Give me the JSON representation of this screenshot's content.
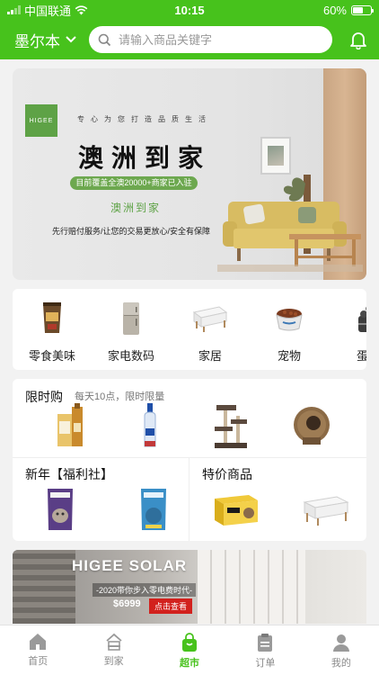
{
  "status_bar": {
    "carrier": "中国联通",
    "time": "10:15",
    "battery": "60%",
    "battery_level": 0.6
  },
  "header": {
    "city": "墨尔本",
    "search_placeholder": "请输入商品关键字"
  },
  "banner": {
    "logo_text": "HIGEE",
    "slogan": "专心为您打造品质生活",
    "title": "澳洲到家",
    "pill": "目前覆盖全澳20000+商家已入驻",
    "subtitle": "澳洲到家",
    "note": "先行赔付服务/让您的交易更放心/安全有保障"
  },
  "categories": [
    {
      "label": "零食美味",
      "icon": "snack-icon"
    },
    {
      "label": "家电数码",
      "icon": "fridge-icon"
    },
    {
      "label": "家居",
      "icon": "furniture-icon"
    },
    {
      "label": "宠物",
      "icon": "pet-bowl-icon"
    },
    {
      "label": "蛋糕",
      "icon": "cake-icon"
    }
  ],
  "flash_sale": {
    "title": "限时购",
    "subtitle": "每天10点，限时限量"
  },
  "new_year": {
    "title": "新年【福利社】"
  },
  "special": {
    "title": "特价商品"
  },
  "solar_banner": {
    "title": "HIGEE SOLAR",
    "tagline": "-2020带你步入零电费时代-",
    "price": "$6999",
    "cta": "点击查看"
  },
  "tabs": [
    {
      "label": "首页",
      "icon": "home-icon"
    },
    {
      "label": "到家",
      "icon": "house-icon"
    },
    {
      "label": "超市",
      "icon": "shopping-bag-icon",
      "active": true
    },
    {
      "label": "订单",
      "icon": "order-icon"
    },
    {
      "label": "我的",
      "icon": "user-icon"
    }
  ],
  "colors": {
    "brand_green": "#47c21c",
    "banner_green": "#6da84f",
    "sale_red": "#d2211d"
  }
}
